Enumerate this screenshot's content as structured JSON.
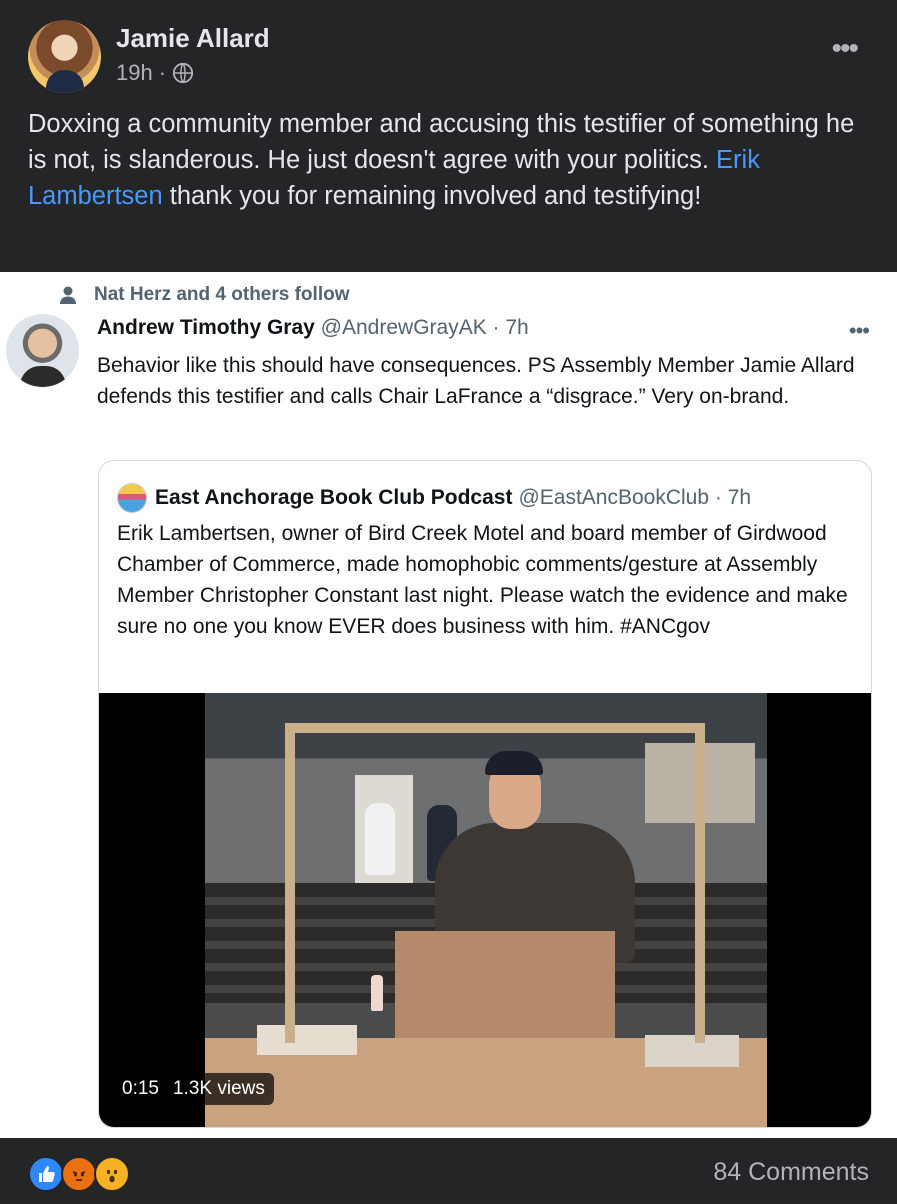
{
  "post": {
    "author": "Jamie Allard",
    "time": "19h",
    "separator": "·",
    "text_before_link": "Doxxing a community member and accusing this testifier of something he is not, is slanderous. He just doesn't agree with your politics. ",
    "link_text": "Erik Lambertsen",
    "text_after_link": " thank you for remaining involved and testifying!",
    "icons": {
      "privacy": "globe-icon",
      "menu": "more-icon"
    }
  },
  "tweet": {
    "social_context": "Nat Herz and 4 others follow",
    "name": "Andrew Timothy Gray",
    "handle": "@AndrewGrayAK · 7h",
    "text": "Behavior like this should have consequences. PS Assembly Member Jamie Allard defends this testifier and calls Chair LaFrance a “disgrace.” Very on-brand.",
    "quote": {
      "name": "East Anchorage Book Club Podcast",
      "handle": "@EastAncBookClub · 7h",
      "text": "Erik Lambertsen, owner of Bird Creek Motel and board member of Girdwood Chamber of Commerce, made homophobic comments/gesture at Assembly Member  Christopher Constant last night. Please watch the evidence and make sure no one you know EVER does business with him. #ANCgov",
      "video": {
        "duration": "0:15",
        "views": "1.3K views"
      }
    }
  },
  "footer": {
    "reactions": [
      "like-icon",
      "angry-icon",
      "wow-icon"
    ],
    "comments": "84 Comments"
  },
  "colors": {
    "background": "#242526",
    "link": "#4599ff",
    "text": "#e4e6eb",
    "muted": "#b0b3b8"
  }
}
